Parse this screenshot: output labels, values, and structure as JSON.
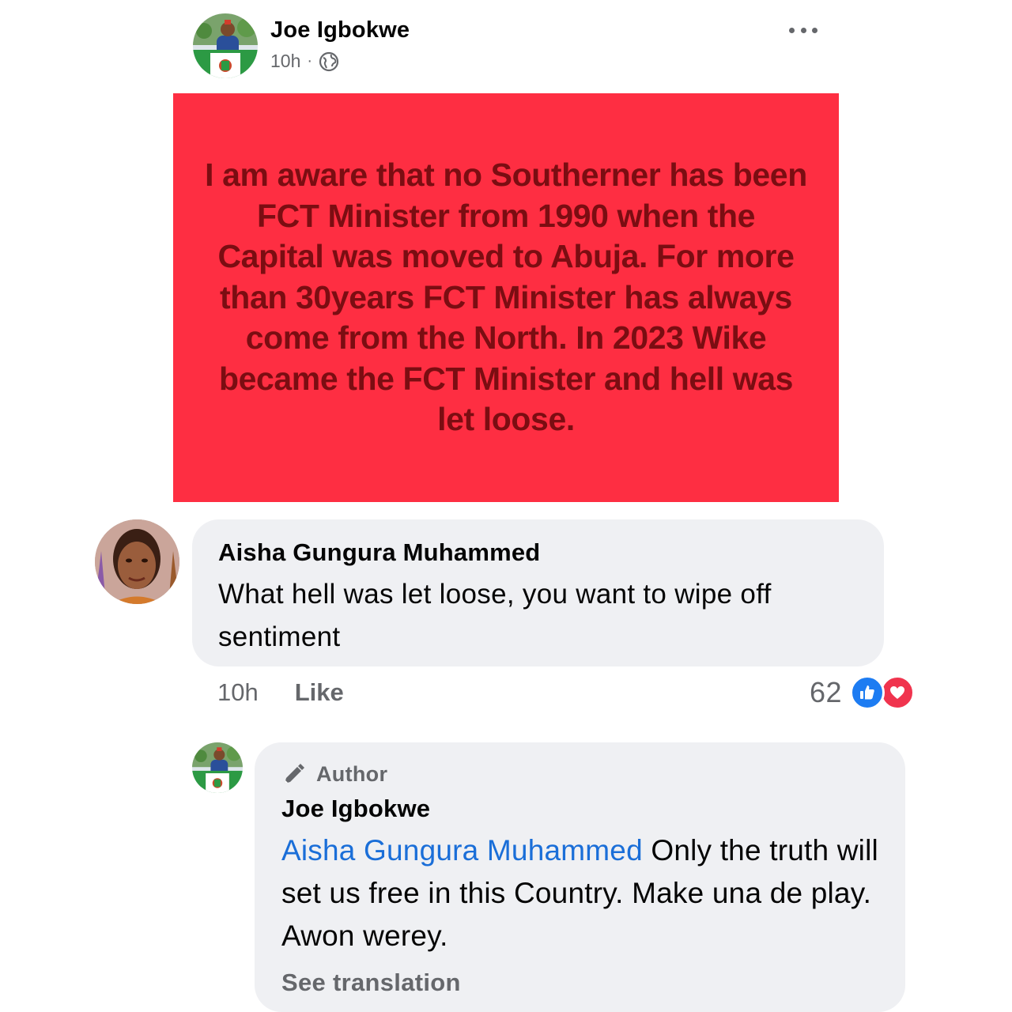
{
  "post": {
    "author": "Joe Igbokwe",
    "time": "10h",
    "separator": "·",
    "privacy_icon": "globe-icon",
    "more_icon": "more-options-icon",
    "background_color": "#fe2e42",
    "text_color": "#7b0d12",
    "text": "I am aware that no Southerner has been FCT Minister from 1990 when the Capital was moved to Abuja. For more than 30years FCT Minister has always come from the North. In 2023 Wike became the FCT Minister and hell was let loose."
  },
  "comment": {
    "author": "Aisha Gungura Muhammed",
    "text": "What hell was let loose, you want to wipe off sentiment",
    "time": "10h",
    "like_label": "Like",
    "reaction_count": "62",
    "reaction_icons": [
      "like-reaction-icon",
      "love-reaction-icon"
    ]
  },
  "reply": {
    "badge": "Author",
    "badge_icon": "pencil-icon",
    "author": "Joe Igbokwe",
    "mention": "Aisha Gungura Muhammed",
    "text": " Only the truth will set us free in this Country. Make una de play. Awon werey.",
    "see_translation": "See translation",
    "mention_color": "#1a6ed8"
  }
}
